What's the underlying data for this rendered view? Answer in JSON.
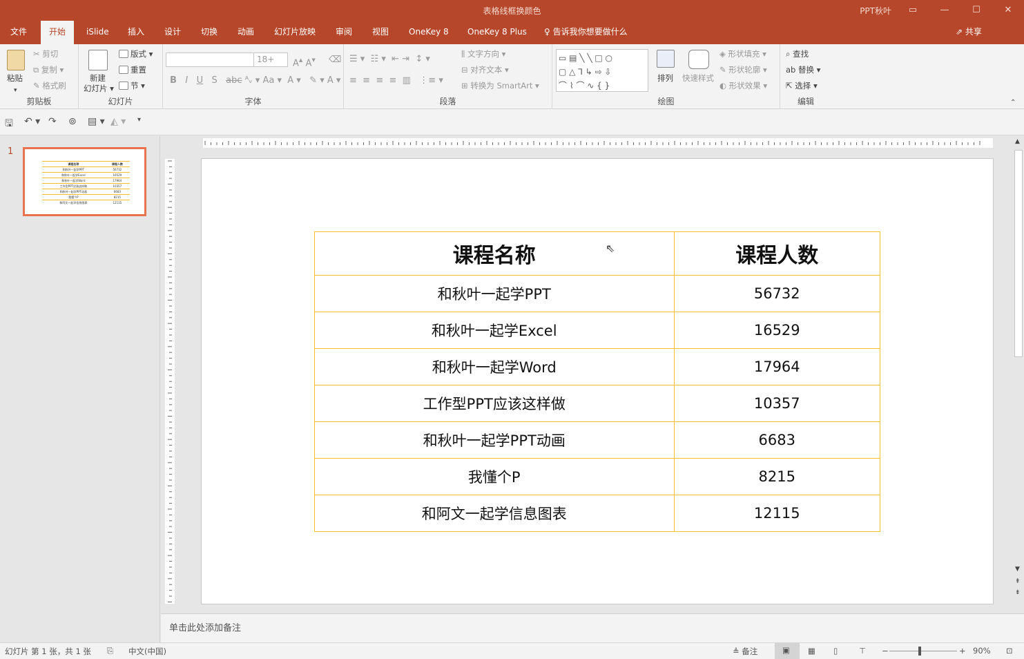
{
  "window": {
    "title": "表格线框换颜色",
    "user": "PPT秋叶"
  },
  "tabs": [
    {
      "label": "文件"
    },
    {
      "label": "开始"
    },
    {
      "label": "iSlide"
    },
    {
      "label": "插入"
    },
    {
      "label": "设计"
    },
    {
      "label": "切换"
    },
    {
      "label": "动画"
    },
    {
      "label": "幻灯片放映"
    },
    {
      "label": "审阅"
    },
    {
      "label": "视图"
    },
    {
      "label": "OneKey 8"
    },
    {
      "label": "OneKey 8 Plus"
    }
  ],
  "tellme": "告诉我你想要做什么",
  "share": "共享",
  "ribbon": {
    "clipboard": {
      "paste": "粘贴",
      "cut": "剪切",
      "copy": "复制",
      "format_painter": "格式刷",
      "label": "剪贴板"
    },
    "slides": {
      "new_slide_1": "新建",
      "new_slide_2": "幻灯片",
      "layout": "版式",
      "reset": "重置",
      "section": "节",
      "label": "幻灯片"
    },
    "font": {
      "font_name": "",
      "font_size": "18+",
      "label": "字体"
    },
    "paragraph": {
      "text_direction": "文字方向",
      "align_text": "对齐文本",
      "smartart": "转换为 SmartArt",
      "label": "段落"
    },
    "drawing": {
      "arrange": "排列",
      "quick_styles": "快速样式",
      "shape_fill": "形状填充",
      "shape_outline": "形状轮廓",
      "shape_effects": "形状效果",
      "label": "绘图"
    },
    "editing": {
      "find": "查找",
      "replace": "替换",
      "select": "选择",
      "label": "编辑"
    }
  },
  "slide_panel": {
    "number": "1"
  },
  "table": {
    "headers": [
      "课程名称",
      "课程人数"
    ],
    "rows": [
      [
        "和秋叶一起学PPT",
        "56732"
      ],
      [
        "和秋叶一起学Excel",
        "16529"
      ],
      [
        "和秋叶一起学Word",
        "17964"
      ],
      [
        "工作型PPT应该这样做",
        "10357"
      ],
      [
        "和秋叶一起学PPT动画",
        "6683"
      ],
      [
        "我懂个P",
        "8215"
      ],
      [
        "和阿文一起学信息图表",
        "12115"
      ]
    ],
    "border_color": "#f5c02a"
  },
  "notes_placeholder": "单击此处添加备注",
  "status": {
    "slide_info": "幻灯片 第 1 张，共 1 张",
    "language": "中文(中国)",
    "notes": "备注",
    "zoom": "90%"
  },
  "colors": {
    "accent": "#b7472a",
    "thumb_border": "#e8744f"
  }
}
